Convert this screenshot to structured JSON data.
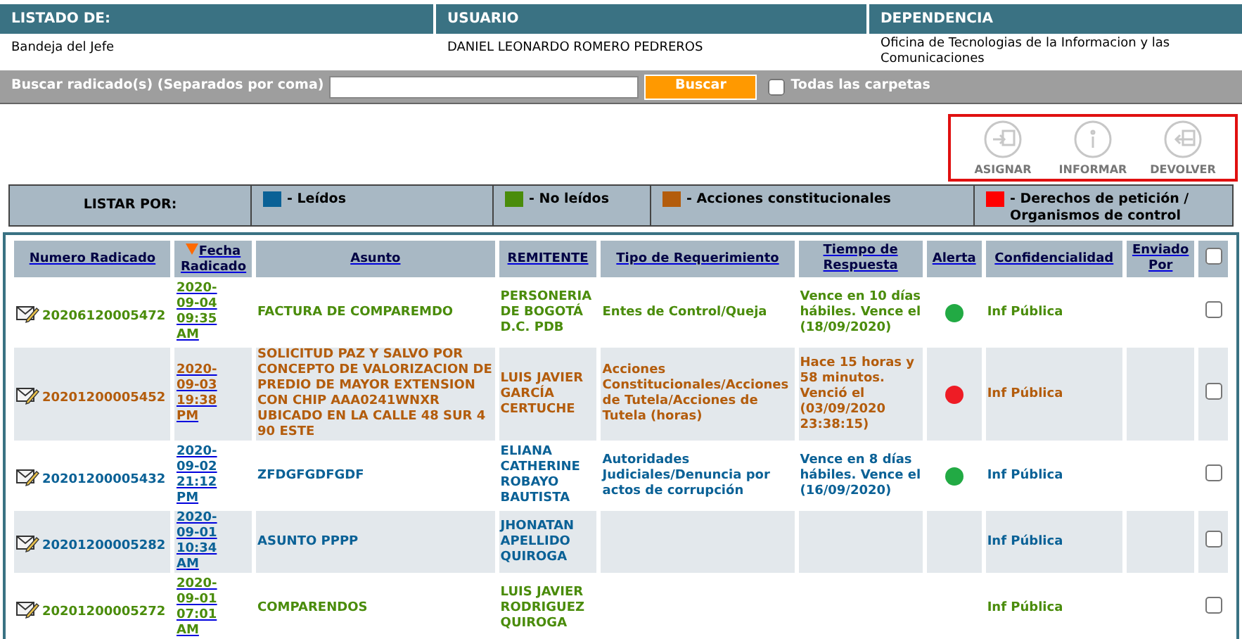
{
  "header": {
    "columns": [
      {
        "label": "LISTADO DE:",
        "value": "Bandeja del Jefe"
      },
      {
        "label": "USUARIO",
        "value": "DANIEL LEONARDO ROMERO PEDREROS"
      },
      {
        "label": "DEPENDENCIA",
        "value": "Oficina de Tecnologias de la Informacion y las Comunicaciones"
      }
    ]
  },
  "search": {
    "label": "Buscar radicado(s) (Separados por coma)",
    "button": "Buscar",
    "all_folders": {
      "label": "Todas las carpetas",
      "checked": false
    }
  },
  "actions": [
    {
      "kind": "assign",
      "label": "ASIGNAR"
    },
    {
      "kind": "inform",
      "label": "INFORMAR"
    },
    {
      "kind": "return",
      "label": "DEVOLVER"
    }
  ],
  "legend": {
    "title": "LISTAR POR:",
    "items": [
      {
        "label": "- Leídos",
        "color": "#0a6196"
      },
      {
        "label": "- No leídos",
        "color": "#4a8c0b"
      },
      {
        "label": "- Acciones constitucionales",
        "color": "#b35c0c"
      },
      {
        "label": "- Derechos de petición / Organismos de control",
        "color": "#ff0000"
      }
    ]
  },
  "table": {
    "columns": [
      {
        "label": "Numero Radicado",
        "sorted": false
      },
      {
        "label": "Fecha Radicado",
        "sorted": true
      },
      {
        "label": "Asunto",
        "sorted": false
      },
      {
        "label": "REMITENTE",
        "sorted": false
      },
      {
        "label": "Tipo de Requerimiento",
        "sorted": false
      },
      {
        "label": "Tiempo de Respuesta",
        "sorted": false
      },
      {
        "label": "Alerta",
        "sorted": false
      },
      {
        "label": "Confidencialidad",
        "sorted": false
      },
      {
        "label": "Enviado Por",
        "sorted": false
      }
    ],
    "select_all": {
      "checked": false
    },
    "rows": [
      {
        "kind": "unread",
        "number": "20206120005472",
        "date": "2020-09-04 09:35 AM",
        "subject": "FACTURA DE COMPAREMDO",
        "sender": "PERSONERIA DE BOGOTÁ D.C. PDB",
        "type": "Entes de Control/Queja",
        "response_time": "Vence en 10 días hábiles. Vence el (18/09/2020)",
        "alert": {
          "color": "#22aa44"
        },
        "confidentiality": "Inf Pública",
        "checked": false
      },
      {
        "kind": "constitutional",
        "number": "20201200005452",
        "date": "2020-09-03 19:38 PM",
        "subject": "SOLICITUD PAZ Y SALVO POR CONCEPTO DE VALORIZACION DE PREDIO DE MAYOR EXTENSION CON CHIP AAA0241WNXR UBICADO EN LA CALLE 48 SUR 4 90 ESTE",
        "sender": "LUIS JAVIER GARCÍA CERTUCHE",
        "type": "Acciones Constitucionales/Acciones de Tutela/Acciones de Tutela (horas)",
        "response_time": "Hace 15 horas y 58 minutos. Venció el (03/09/2020 23:38:15)",
        "alert": {
          "color": "#ee1c25"
        },
        "confidentiality": "Inf Pública",
        "checked": false
      },
      {
        "kind": "read",
        "number": "20201200005432",
        "date": "2020-09-02 21:12 PM",
        "subject": "ZFDGFGDFGDF",
        "sender": "ELIANA CATHERINE ROBAYO BAUTISTA",
        "type": "Autoridades Judiciales/Denuncia por actos de corrupción",
        "response_time": "Vence en 8 días hábiles. Vence el (16/09/2020)",
        "alert": {
          "color": "#22aa44"
        },
        "confidentiality": "Inf Pública",
        "checked": false
      },
      {
        "kind": "read",
        "number": "20201200005282",
        "date": "2020-09-01 10:34 AM",
        "subject": "ASUNTO PPPP",
        "sender": "JHONATAN APELLIDO QUIROGA",
        "confidentiality": "Inf Pública",
        "checked": false
      },
      {
        "kind": "unread",
        "number": "20201200005272",
        "date": "2020-09-01 07:01 AM",
        "subject": "COMPARENDOS",
        "sender": "LUIS JAVIER RODRIGUEZ QUIROGA",
        "confidentiality": "Inf Pública",
        "checked": false
      }
    ]
  }
}
